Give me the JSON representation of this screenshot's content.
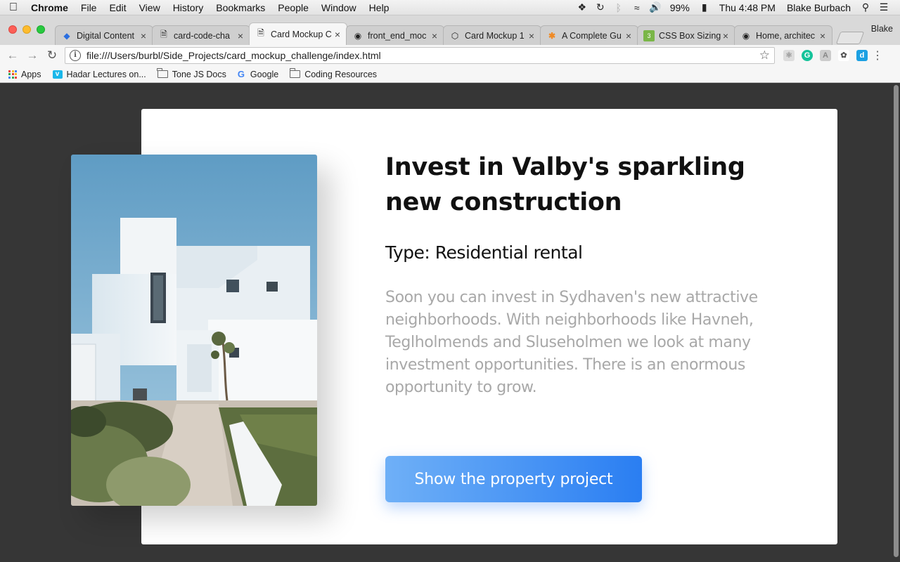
{
  "menubar": {
    "app": "Chrome",
    "items": [
      "File",
      "Edit",
      "View",
      "History",
      "Bookmarks",
      "People",
      "Window",
      "Help"
    ],
    "battery": "99%",
    "clock": "Thu 4:48 PM",
    "user": "Blake Burbach"
  },
  "tabs": [
    {
      "title": "Digital Content",
      "icon": "diamond-icon"
    },
    {
      "title": "card-code-cha",
      "icon": "file-icon"
    },
    {
      "title": "Card Mockup C",
      "icon": "file-icon",
      "active": true
    },
    {
      "title": "front_end_moc",
      "icon": "github-icon"
    },
    {
      "title": "Card Mockup 1",
      "icon": "codepen-icon"
    },
    {
      "title": "A Complete Gu",
      "icon": "asterisk-icon"
    },
    {
      "title": "CSS Box Sizing",
      "icon": "css3-icon"
    },
    {
      "title": "Home, architec",
      "icon": "camera-icon"
    }
  ],
  "profile_name": "Blake",
  "address": {
    "url": "file:///Users/burbl/Side_Projects/card_mockup_challenge/index.html"
  },
  "bookmarks": [
    {
      "label": "Apps",
      "icon": "apps-grid-icon"
    },
    {
      "label": "Hadar Lectures on...",
      "icon": "vimeo-icon"
    },
    {
      "label": "Tone JS Docs",
      "icon": "folder-icon"
    },
    {
      "label": "Google",
      "icon": "google-icon"
    },
    {
      "label": "Coding Resources",
      "icon": "folder-icon"
    }
  ],
  "card": {
    "headline": "Invest in Valby's sparkling new construction",
    "type": "Type: Residential rental",
    "description": "Soon you can invest in Sydhaven's new attractive neighborhoods. With neighborhoods like Havneh, Teglholmends and Sluseholmen we look at many investment opportunities. There is an enormous opportunity to grow.",
    "cta": "Show the property project"
  },
  "colors": {
    "page_bg": "#363636",
    "cta_start": "#6fb0f7",
    "cta_end": "#2a7ef2",
    "description": "#a8a8a8"
  }
}
